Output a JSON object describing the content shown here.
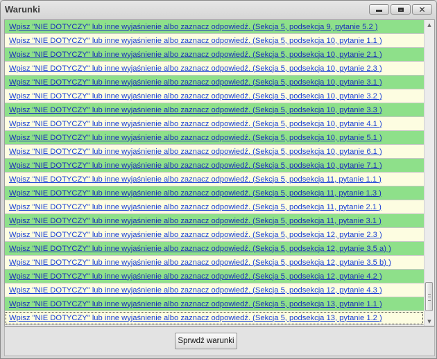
{
  "window": {
    "title": "Warunki"
  },
  "rows": [
    {
      "text": "Wpisz \"NIE DOTYCZY\" lub inne wyjaśnienie albo zaznacz odpowiedź. (Sekcja 5, podsekcja 9, pytanie 5.2 )",
      "color": "green"
    },
    {
      "text": "Wpisz \"NIE DOTYCZY\" lub inne wyjaśnienie albo zaznacz odpowiedź. (Sekcja 5, podsekcja 10, pytanie 1.1 )",
      "color": "cream"
    },
    {
      "text": "Wpisz \"NIE DOTYCZY\" lub inne wyjaśnienie albo zaznacz odpowiedź. (Sekcja 5, podsekcja 10, pytanie 2.1 )",
      "color": "green"
    },
    {
      "text": "Wpisz \"NIE DOTYCZY\" lub inne wyjaśnienie albo zaznacz odpowiedź. (Sekcja 5, podsekcja 10, pytanie 2.3 )",
      "color": "cream"
    },
    {
      "text": "Wpisz \"NIE DOTYCZY\" lub inne wyjaśnienie albo zaznacz odpowiedź. (Sekcja 5, podsekcja 10, pytanie 3.1 )",
      "color": "green"
    },
    {
      "text": "Wpisz \"NIE DOTYCZY\" lub inne wyjaśnienie albo zaznacz odpowiedź. (Sekcja 5, podsekcja 10, pytanie 3.2 )",
      "color": "cream"
    },
    {
      "text": "Wpisz \"NIE DOTYCZY\" lub inne wyjaśnienie albo zaznacz odpowiedź. (Sekcja 5, podsekcja 10, pytanie 3.3 )",
      "color": "green"
    },
    {
      "text": "Wpisz \"NIE DOTYCZY\" lub inne wyjaśnienie albo zaznacz odpowiedź. (Sekcja 5, podsekcja 10, pytanie 4.1 )",
      "color": "cream"
    },
    {
      "text": "Wpisz \"NIE DOTYCZY\" lub inne wyjaśnienie albo zaznacz odpowiedź. (Sekcja 5, podsekcja 10, pytanie 5.1 )",
      "color": "green"
    },
    {
      "text": "Wpisz \"NIE DOTYCZY\" lub inne wyjaśnienie albo zaznacz odpowiedź. (Sekcja 5, podsekcja 10, pytanie 6.1 )",
      "color": "cream"
    },
    {
      "text": "Wpisz \"NIE DOTYCZY\" lub inne wyjaśnienie albo zaznacz odpowiedź. (Sekcja 5, podsekcja 10, pytanie 7.1 )",
      "color": "green"
    },
    {
      "text": "Wpisz \"NIE DOTYCZY\" lub inne wyjaśnienie albo zaznacz odpowiedź. (Sekcja 5, podsekcja 11, pytanie 1.1 )",
      "color": "cream"
    },
    {
      "text": "Wpisz \"NIE DOTYCZY\" lub inne wyjaśnienie albo zaznacz odpowiedź. (Sekcja 5, podsekcja 11, pytanie 1.3 )",
      "color": "green"
    },
    {
      "text": "Wpisz \"NIE DOTYCZY\" lub inne wyjaśnienie albo zaznacz odpowiedź. (Sekcja 5, podsekcja 11, pytanie 2.1 )",
      "color": "cream"
    },
    {
      "text": "Wpisz \"NIE DOTYCZY\" lub inne wyjaśnienie albo zaznacz odpowiedź. (Sekcja 5, podsekcja 11, pytanie 3.1 )",
      "color": "green"
    },
    {
      "text": "Wpisz \"NIE DOTYCZY\" lub inne wyjaśnienie albo zaznacz odpowiedź. (Sekcja 5, podsekcja 12, pytanie 2.3 )",
      "color": "cream"
    },
    {
      "text": "Wpisz \"NIE DOTYCZY\" lub inne wyjaśnienie albo zaznacz odpowiedź. (Sekcja 5, podsekcja 12, pytanie 3.5 a) )",
      "color": "green"
    },
    {
      "text": "Wpisz \"NIE DOTYCZY\" lub inne wyjaśnienie albo zaznacz odpowiedź. (Sekcja 5, podsekcja 12, pytanie 3.5 b) )",
      "color": "cream"
    },
    {
      "text": "Wpisz \"NIE DOTYCZY\" lub inne wyjaśnienie albo zaznacz odpowiedź. (Sekcja 5, podsekcja 12, pytanie 4.2 )",
      "color": "green"
    },
    {
      "text": "Wpisz \"NIE DOTYCZY\" lub inne wyjaśnienie albo zaznacz odpowiedź. (Sekcja 5, podsekcja 12, pytanie 4.3 )",
      "color": "cream"
    },
    {
      "text": "Wpisz \"NIE DOTYCZY\" lub inne wyjaśnienie albo zaznacz odpowiedź. (Sekcja 5, podsekcja 13, pytanie 1.1 )",
      "color": "green"
    },
    {
      "text": "Wpisz \"NIE DOTYCZY\" lub inne wyjaśnienie albo zaznacz odpowiedź. (Sekcja 5, podsekcja 13, pytanie 1.2 )",
      "color": "cream",
      "selected": true
    }
  ],
  "footer": {
    "check_button_label": "Sprwdź warunki"
  },
  "colors": {
    "row_green": "#8ee08a",
    "row_cream": "#fdfde1",
    "link": "#1a3fd6"
  }
}
